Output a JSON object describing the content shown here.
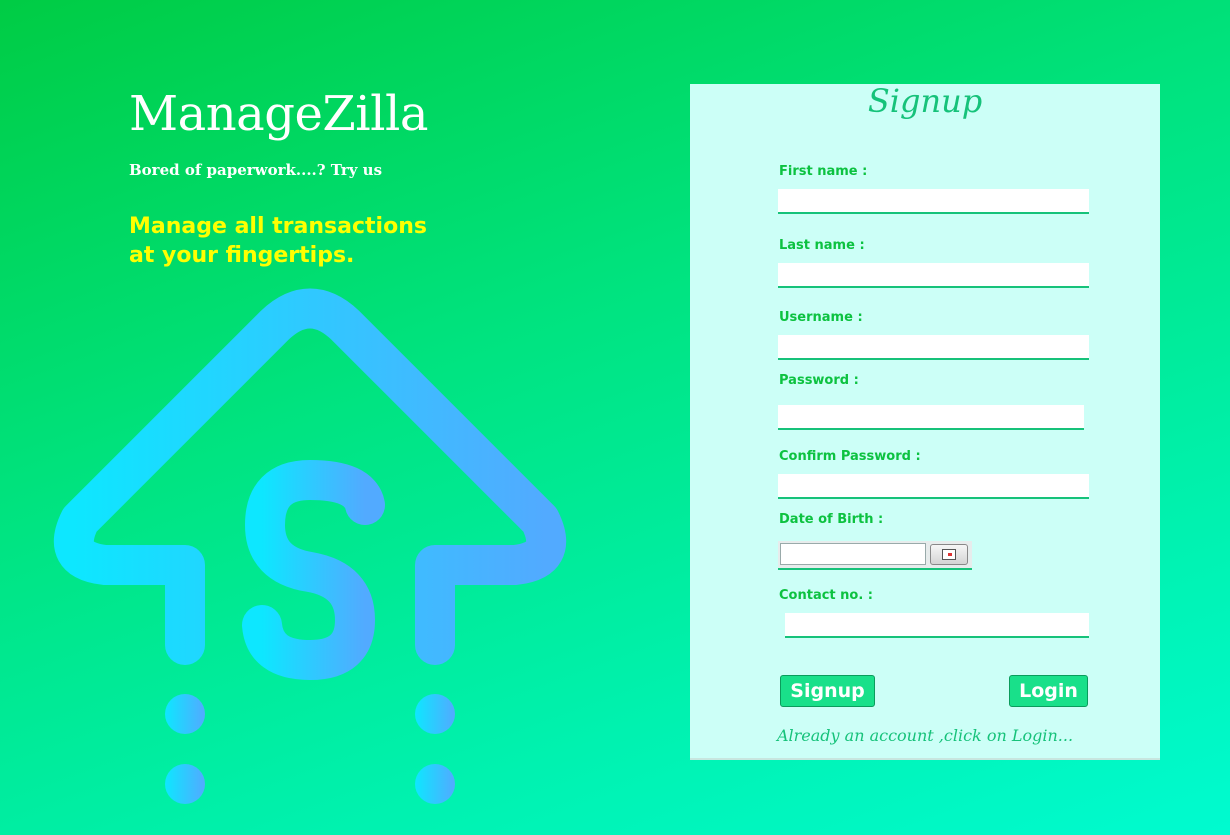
{
  "brand": {
    "name": "ManageZilla",
    "tagline": "Bored of paperwork....? Try us",
    "headline_line1": "Manage all transactions",
    "headline_line2": "at your fingertips."
  },
  "form": {
    "title": "Signup",
    "first_name_label": "First name :",
    "last_name_label": "Last name :",
    "username_label": "Username :",
    "password_label": "Password :",
    "confirm_password_label": "Confirm Password :",
    "dob_label": "Date of Birth :",
    "contact_label": "Contact no. :",
    "first_name_value": "",
    "last_name_value": "",
    "username_value": "",
    "password_value": "",
    "confirm_password_value": "",
    "dob_value": "",
    "contact_value": "",
    "signup_button": "Signup",
    "login_button": "Login",
    "footer_note": "Already an account ,click on Login..."
  },
  "colors": {
    "accent": "#16c27a",
    "label": "#0cc240",
    "headline": "#ffff00",
    "panel": "#ccfff7"
  },
  "icons": {
    "hero": "money-up-arrow-icon",
    "calendar": "calendar-icon"
  }
}
